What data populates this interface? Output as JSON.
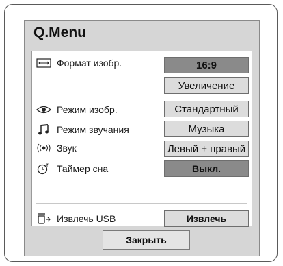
{
  "menu": {
    "title": "Q.Menu",
    "rows": [
      {
        "icon": "aspect-ratio-icon",
        "label": "Формат изобр.",
        "value": "16:9"
      },
      {
        "icon": "",
        "label": "",
        "value": "Увеличение"
      },
      {
        "icon": "eye-icon",
        "label": "Режим изобр.",
        "value": "Стандартный"
      },
      {
        "icon": "music-note-icon",
        "label": "Режим звучания",
        "value": "Музыка"
      },
      {
        "icon": "speaker-icon",
        "label": "Звук",
        "value": "Левый + правый"
      },
      {
        "icon": "sleep-timer-icon",
        "label": "Таймер сна",
        "value": "Выкл."
      },
      {
        "icon": "usb-eject-icon",
        "label": "Извлечь USB",
        "value": "Извлечь"
      }
    ],
    "close_label": "Закрыть"
  }
}
